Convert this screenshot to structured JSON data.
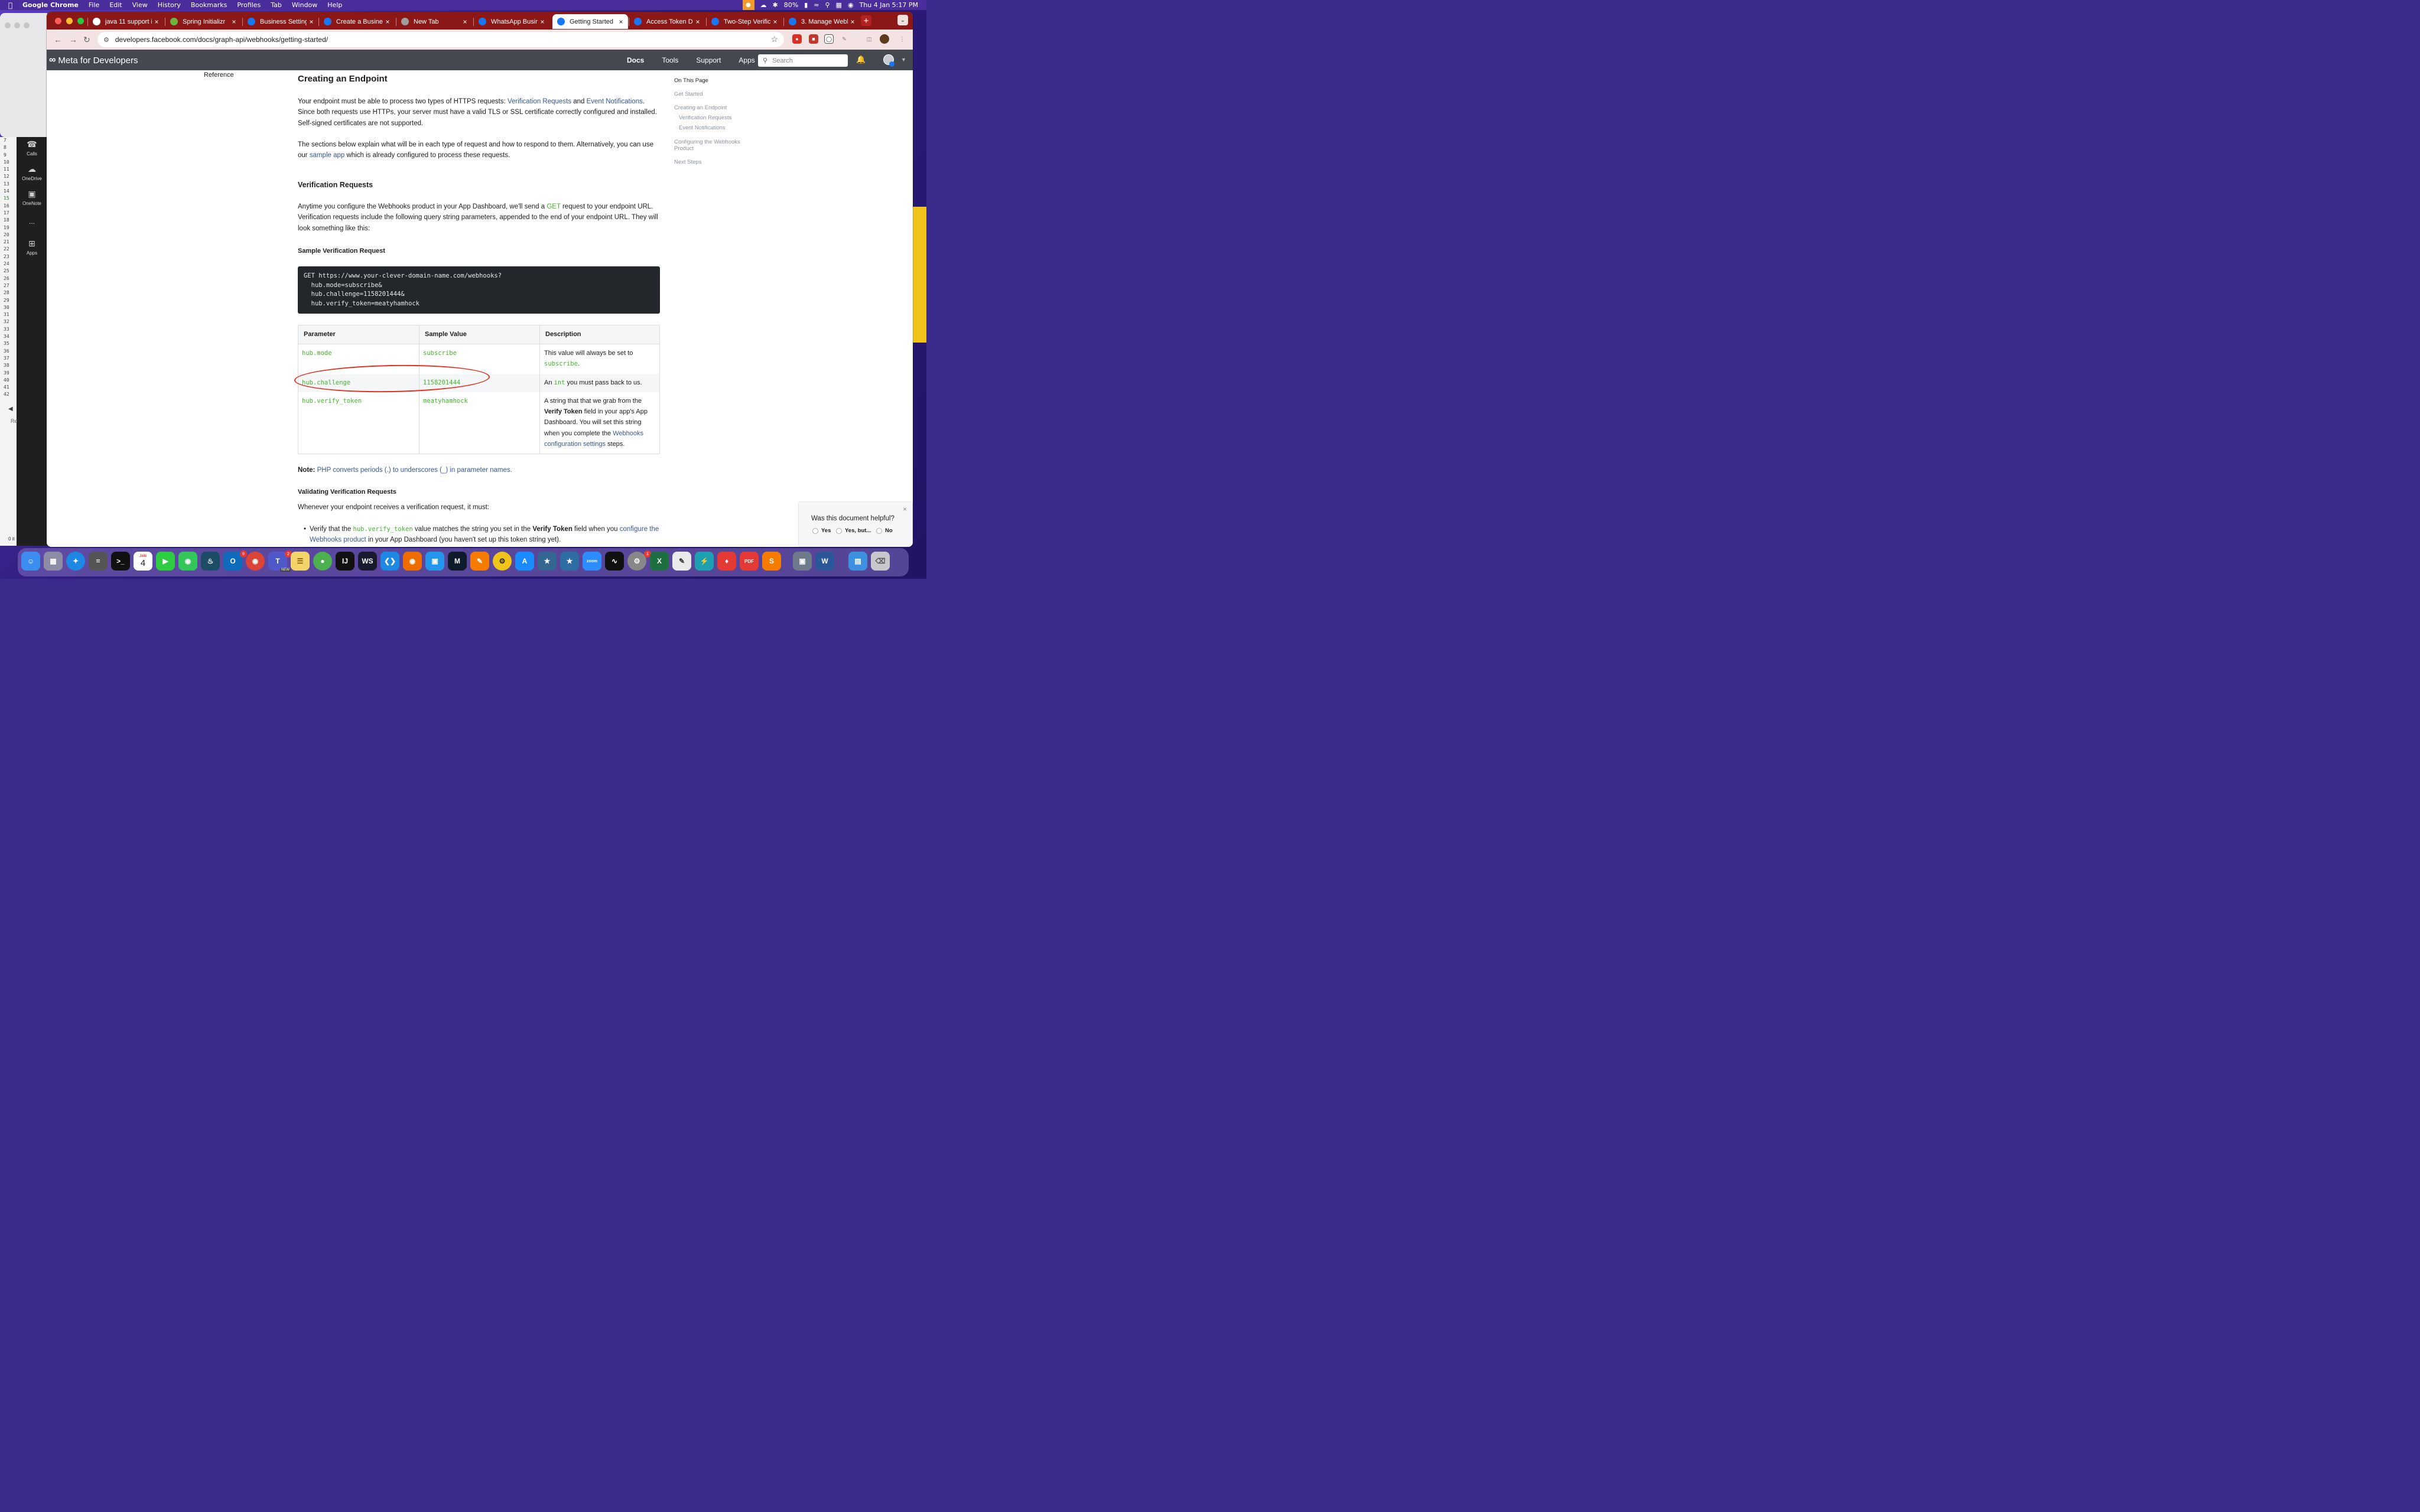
{
  "menubar": {
    "app_name": "Google Chrome",
    "items": [
      "File",
      "Edit",
      "View",
      "History",
      "Bookmarks",
      "Profiles",
      "Tab",
      "Window",
      "Help"
    ],
    "battery": "80%",
    "datetime": "Thu 4 Jan  5:17 PM"
  },
  "tabs": [
    {
      "label": "java 11 support in",
      "icon": "google-icon"
    },
    {
      "label": "Spring Initializr",
      "icon": "spring-icon"
    },
    {
      "label": "Business Settings",
      "icon": "meta-icon"
    },
    {
      "label": "Create a Business",
      "icon": "meta-icon"
    },
    {
      "label": "New Tab",
      "icon": "chrome-icon"
    },
    {
      "label": "WhatsApp Busine",
      "icon": "facebook-icon"
    },
    {
      "label": "Getting Started",
      "icon": "facebook-icon",
      "active": true
    },
    {
      "label": "Access Token Del",
      "icon": "facebook-icon"
    },
    {
      "label": "Two-Step Verifica",
      "icon": "facebook-icon"
    },
    {
      "label": "3. Manage Webhoo",
      "icon": "facebook-icon"
    }
  ],
  "address": {
    "url": "developers.facebook.com/docs/graph-api/webhooks/getting-started/"
  },
  "metanav": {
    "logo": "Meta for Developers",
    "links": [
      "Docs",
      "Tools",
      "Support",
      "Apps"
    ],
    "search_placeholder": "Search"
  },
  "leftnav": {
    "reference": "Reference"
  },
  "doc": {
    "h1": "Creating an Endpoint",
    "p1": {
      "a": "Your endpoint must be able to process two types of HTTPS requests: ",
      "link1": "Verification Requests",
      "b": " and ",
      "link2": "Event Notifications",
      "c": ". Since both requests use HTTPs, your server must have a valid TLS or SSL certificate correctly configured and installed. Self-signed certificates are not supported."
    },
    "p2": {
      "a": "The sections below explain what will be in each type of request and how to respond to them. Alternatively, you can use our ",
      "link": "sample app",
      "b": " which is already configured to process these requests."
    },
    "h2_verification": "Verification Requests",
    "p3": {
      "a": "Anytime you configure the Webhooks product in your App Dashboard, we'll send a ",
      "get": "GET",
      "b": " request to your endpoint URL. Verification requests include the following query string parameters, appended to the end of your endpoint URL. They will look something like this:"
    },
    "h3_sample": "Sample Verification Request",
    "code": "GET https://www.your-clever-domain-name.com/webhooks?\n  hub.mode=subscribe&\n  hub.challenge=1158201444&\n  hub.verify_token=meatyhamhock",
    "table": {
      "headers": [
        "Parameter",
        "Sample Value",
        "Description"
      ],
      "rows": [
        {
          "param": "hub.mode",
          "value": "subscribe",
          "desc_a": "This value will always be set to ",
          "desc_code": "subscribe",
          "desc_b": "."
        },
        {
          "param": "hub.challenge",
          "value": "1158201444",
          "desc_a": "An ",
          "desc_code": "int",
          "desc_b": " you must pass back to us."
        },
        {
          "param": "hub.verify_token",
          "value": "meatyhamhock",
          "desc_a": "A string that that we grab from the ",
          "desc_bold": "Verify Token",
          "desc_b": " field in your app's App Dashboard. You will set this string when you complete the ",
          "desc_link": "Webhooks configuration settings",
          "desc_c": " steps."
        }
      ]
    },
    "note": {
      "label": "Note:",
      "link": "PHP converts periods (.) to underscores (_) in parameter names."
    },
    "h3_validating": "Validating Verification Requests",
    "p4": "Whenever your endpoint receives a verification request, it must:",
    "bullet": {
      "a": "Verify that the ",
      "code": "hub.verify_token",
      "b": " value matches the string you set in the ",
      "bold": "Verify Token",
      "c": " field when you ",
      "link": "configure the Webhooks product",
      "d": " in your App Dashboard (you haven't set up this token string yet)."
    }
  },
  "onthispage": {
    "title": "On This Page",
    "items": [
      "Get Started",
      "Creating an Endpoint",
      "Verification Requests",
      "Event Notifications",
      "Configuring the Webhooks",
      "Product",
      "Next Steps"
    ]
  },
  "feedback": {
    "question": "Was this document helpful?",
    "options": [
      "Yes",
      "Yes, but...",
      "No"
    ]
  },
  "teams": {
    "items": [
      "Calls",
      "OneDrive",
      "OneNote",
      "...",
      "Apps"
    ],
    "bottom_text": "0 it",
    "edge_text": "Re"
  },
  "linenos": [
    "7",
    "8",
    "9",
    "10",
    "11",
    "12",
    "13",
    "14",
    "15",
    "16",
    "17",
    "18",
    "19",
    "20",
    "21",
    "22",
    "23",
    "24",
    "25",
    "26",
    "27",
    "28",
    "29",
    "30",
    "31",
    "32",
    "33",
    "34",
    "35",
    "36",
    "37",
    "38",
    "39",
    "40",
    "41",
    "42"
  ],
  "dock": {
    "calendar_month": "JAN",
    "calendar_day": "4",
    "teams_badge": "2",
    "outlook_badge": "9",
    "settings_badge": "1",
    "teams_new": "NEW"
  },
  "colors": {
    "tab_strip": "#8b1717",
    "meta_nav": "#444950",
    "link": "#385898",
    "code_green": "#42b72a",
    "annotation_red": "#e0311f"
  }
}
